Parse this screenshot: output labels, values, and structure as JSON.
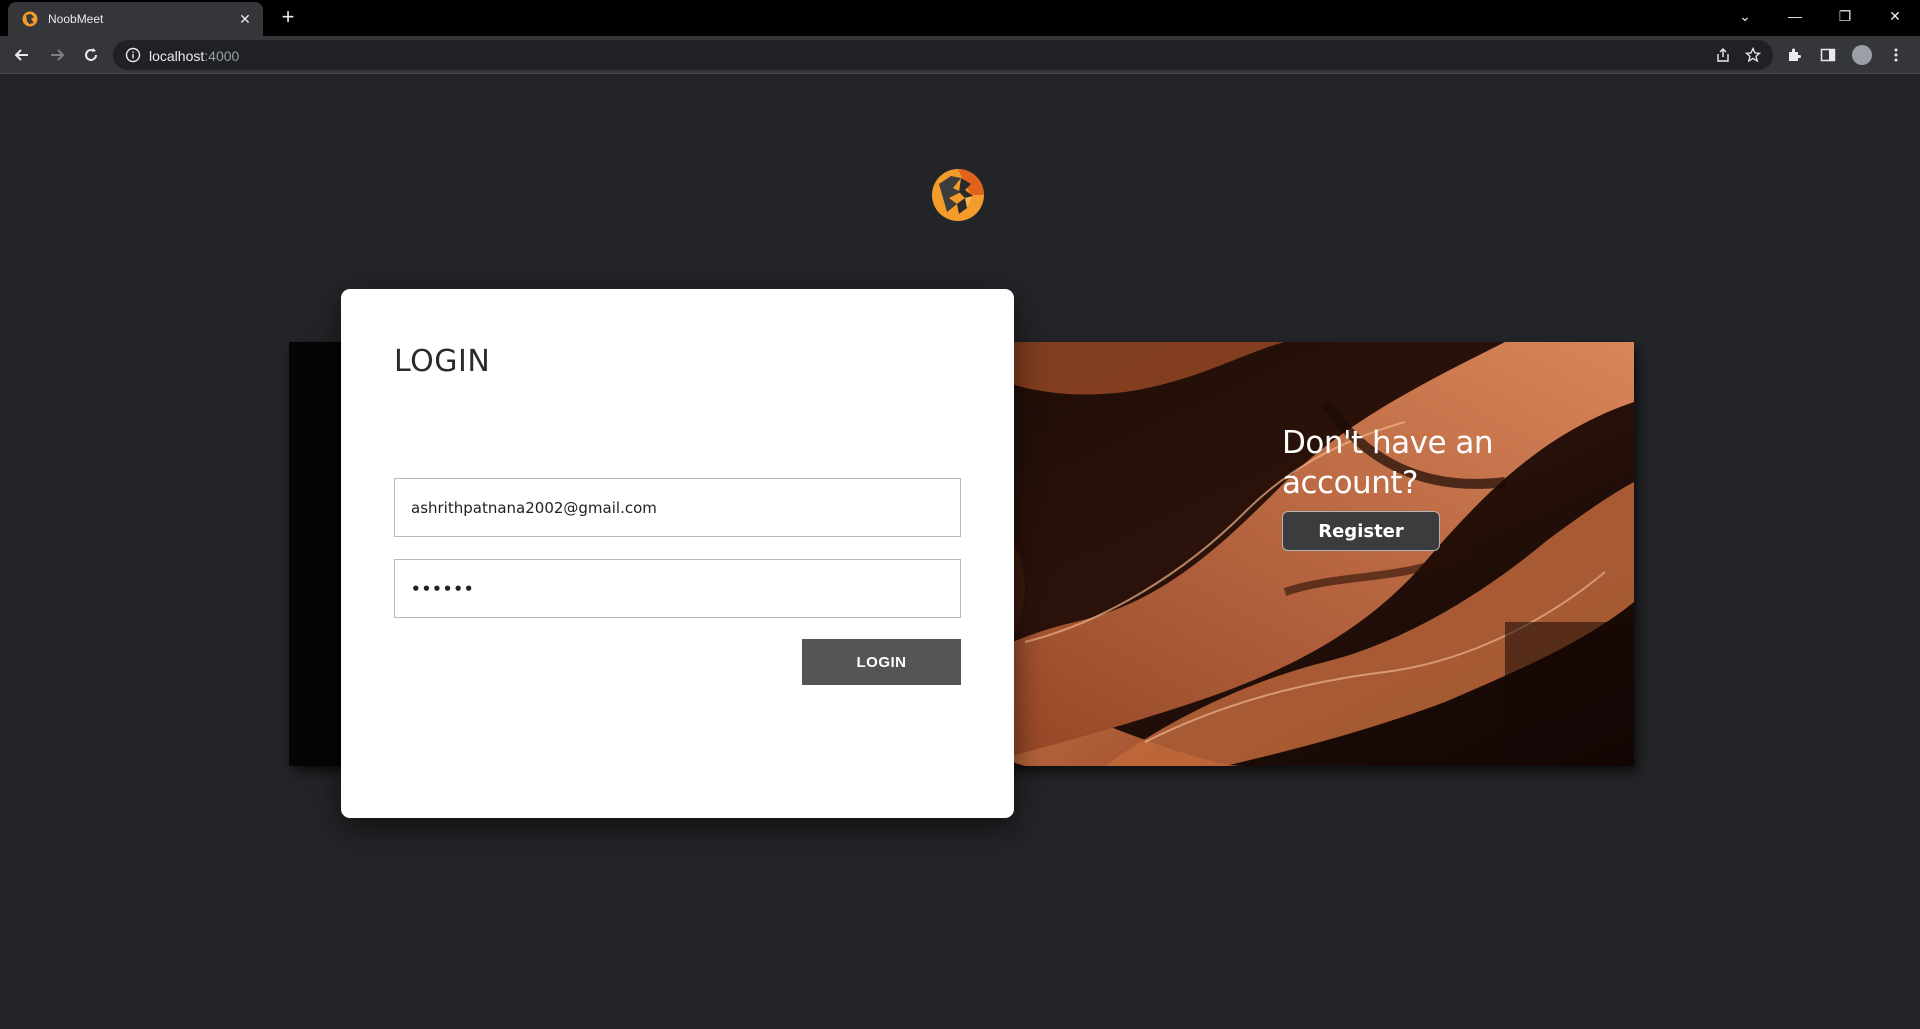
{
  "browser": {
    "tab_title": "NoobMeet",
    "close_glyph": "✕",
    "new_tab_glyph": "+",
    "url_host": "localhost",
    "url_port": ":4000",
    "window_controls": [
      "⌄",
      "—",
      "❐",
      "✕"
    ]
  },
  "brand": {
    "logo_icon": "noobmeet-logo-icon",
    "accent": "#f39c2b"
  },
  "login": {
    "title": "LOGIN",
    "email_value": "ashrithpatnana2002@gmail.com",
    "password_value": "••••••",
    "submit_label": "LOGIN"
  },
  "register": {
    "prompt": "Don't have an account?",
    "button_label": "Register"
  },
  "colors": {
    "page_bg": "#232427",
    "card_bg": "#ffffff",
    "button_bg": "#555555"
  }
}
